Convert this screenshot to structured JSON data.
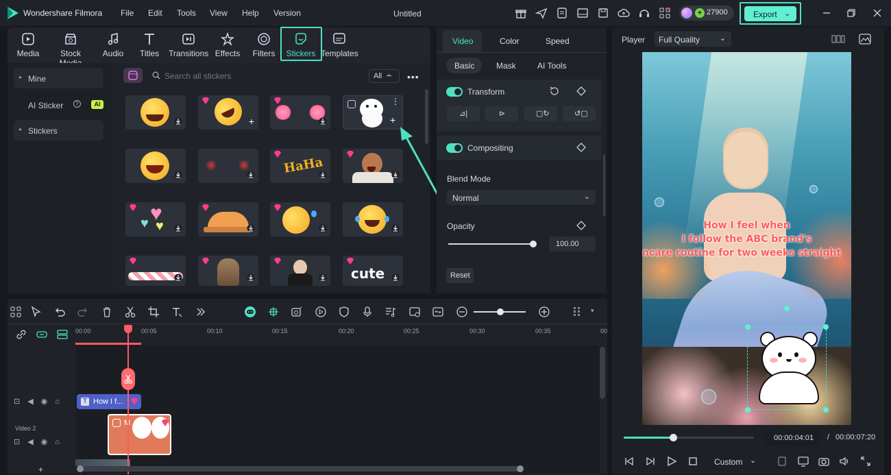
{
  "app": {
    "name": "Wondershare Filmora",
    "doc_title": "Untitled",
    "credits": "27900",
    "export_label": "Export"
  },
  "menu": [
    "File",
    "Edit",
    "Tools",
    "View",
    "Help",
    "Version"
  ],
  "tabs": [
    "Media",
    "Stock Media",
    "Audio",
    "Titles",
    "Transitions",
    "Effects",
    "Filters",
    "Stickers",
    "Templates"
  ],
  "sidebar": {
    "mine": "Mine",
    "ai_sticker": "AI Sticker",
    "ai_badge": "AI",
    "stickers": "Stickers"
  },
  "search": {
    "placeholder": "Search all stickers",
    "filter": "All"
  },
  "sticker_cards": [
    "laughing-emoji",
    "rofl-emoji",
    "blush-cheeks",
    "white-bear",
    "grinning-emoji",
    "red-glow",
    "haha-text",
    "laughing-man",
    "hearts",
    "peeking-cat",
    "tears-of-joy",
    "cry-laugh",
    "loading-bar",
    "cat-photo",
    "facepalm-person",
    "cute-text"
  ],
  "inspector": {
    "tabs": [
      "Video",
      "Color",
      "Speed"
    ],
    "subtabs": [
      "Basic",
      "Mask",
      "AI Tools"
    ],
    "transform": "Transform",
    "compositing": "Compositing",
    "blend_mode_label": "Blend Mode",
    "blend_mode_value": "Normal",
    "opacity_label": "Opacity",
    "opacity_value": "100.00",
    "reset": "Reset"
  },
  "player": {
    "label": "Player",
    "quality": "Full Quality",
    "overlay_text": [
      "How I feel when",
      "I follow the ABC brand's",
      "ncare routine for two weeks straight"
    ],
    "current_time": "00:00:04:01",
    "separator": "/",
    "total_time": "00:00:07:20",
    "zoom": "Custom",
    "progress": 0.38
  },
  "timeline": {
    "ruler": [
      "00:00",
      "00:05",
      "00:10",
      "00:15",
      "00:20",
      "00:25",
      "00:30",
      "00:35",
      "00"
    ],
    "title_clip": "How I f...",
    "video_clip": "M",
    "track2_label": "Video 2",
    "add_track": "+"
  },
  "colors": {
    "accent": "#4fe0c2",
    "export_bg": "#5ff0d4",
    "playhead": "#ff5a5f",
    "premium": "#ff3d8b"
  }
}
